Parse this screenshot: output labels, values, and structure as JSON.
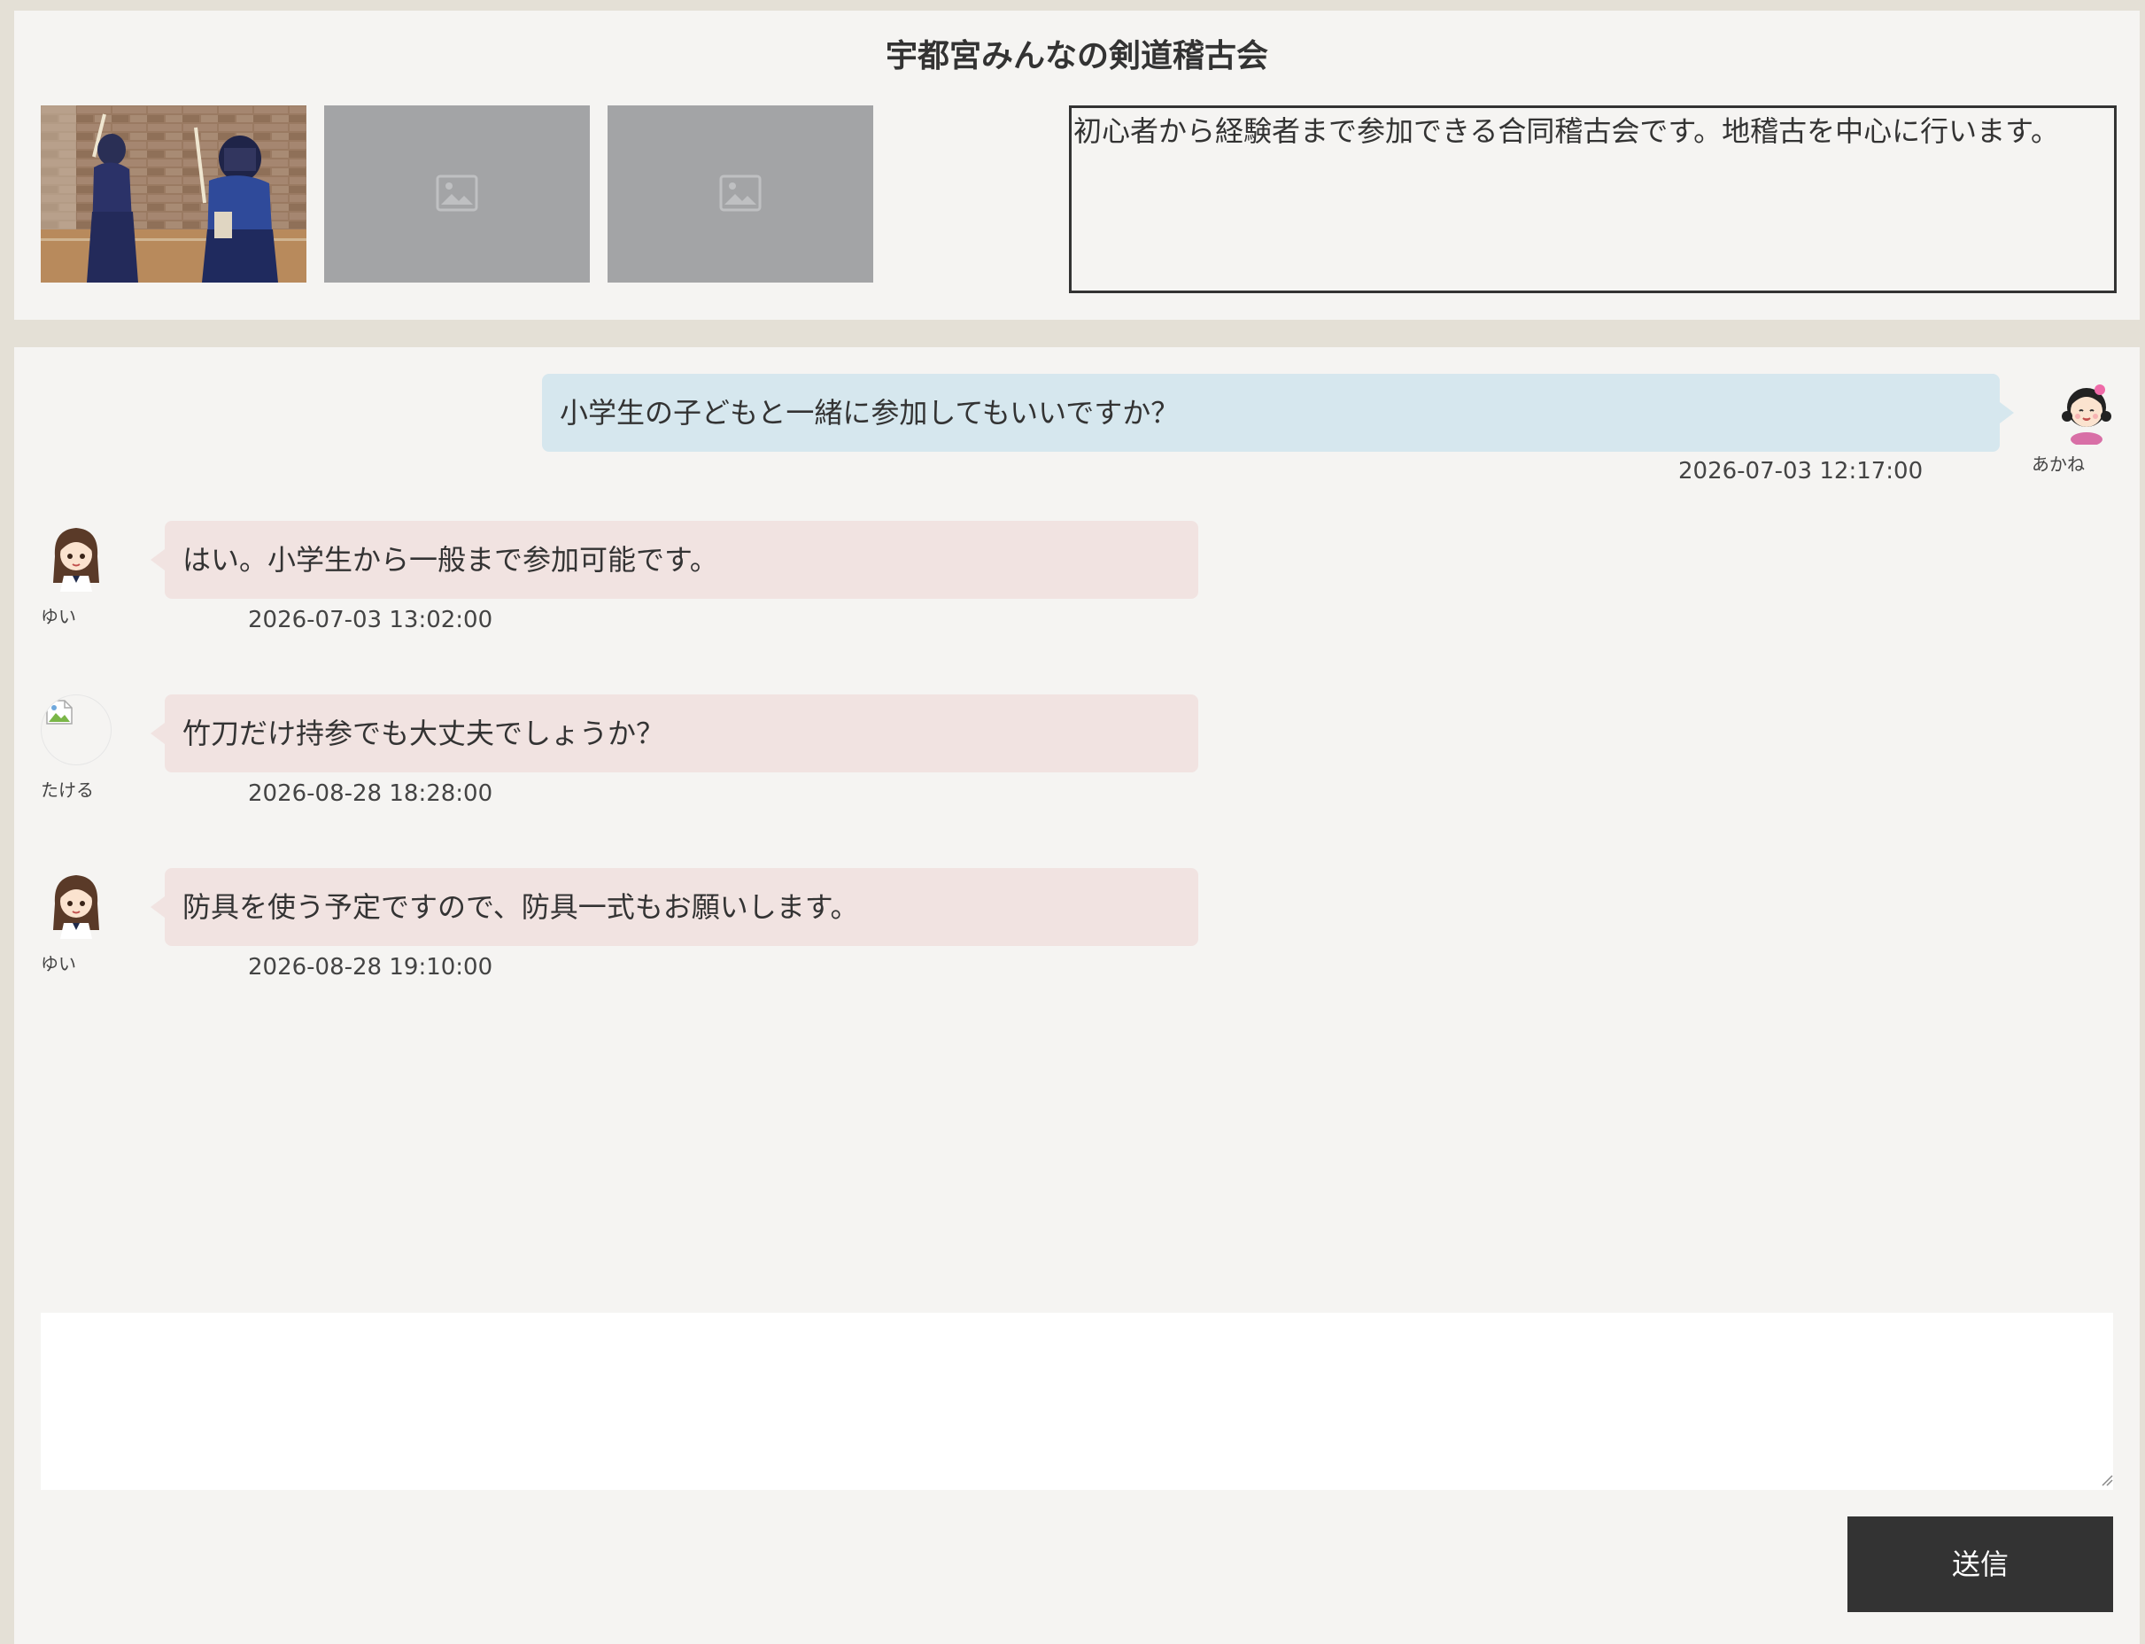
{
  "header": {
    "title": "宇都宮みんなの剣道稽古会",
    "description": "初心者から経験者まで参加できる合同稽古会です。地稽古を中心に行います。",
    "images": [
      {
        "kind": "photo",
        "icon": "kendo-photo"
      },
      {
        "kind": "placeholder",
        "icon": "image-placeholder-icon"
      },
      {
        "kind": "placeholder",
        "icon": "image-placeholder-icon"
      }
    ]
  },
  "messages": [
    {
      "side": "right",
      "user": "あかね",
      "avatar": "girl-avatar-icon",
      "text": "小学生の子どもと一緒に参加してもいいですか？",
      "time": "2026-07-03 12:17:00"
    },
    {
      "side": "left",
      "user": "ゆい",
      "avatar": "girl-avatar-icon",
      "text": "はい。小学生から一般まで参加可能です。",
      "time": "2026-07-03 13:02:00"
    },
    {
      "side": "left",
      "user": "たける",
      "avatar": "broken-image-icon",
      "text": "竹刀だけ持参でも大丈夫でしょうか？",
      "time": "2026-08-28 18:28:00"
    },
    {
      "side": "left",
      "user": "ゆい",
      "avatar": "girl-avatar-icon",
      "text": "防具を使う予定ですので、防具一式もお願いします。",
      "time": "2026-08-28 19:10:00"
    }
  ],
  "composer": {
    "value": "",
    "placeholder": "",
    "send_label": "送信"
  },
  "colors": {
    "background": "#e4e0d6",
    "panel": "#f5f4f2",
    "own_bubble": "#d6e7ee",
    "other_bubble": "#f1e3e1",
    "button": "#333333"
  }
}
